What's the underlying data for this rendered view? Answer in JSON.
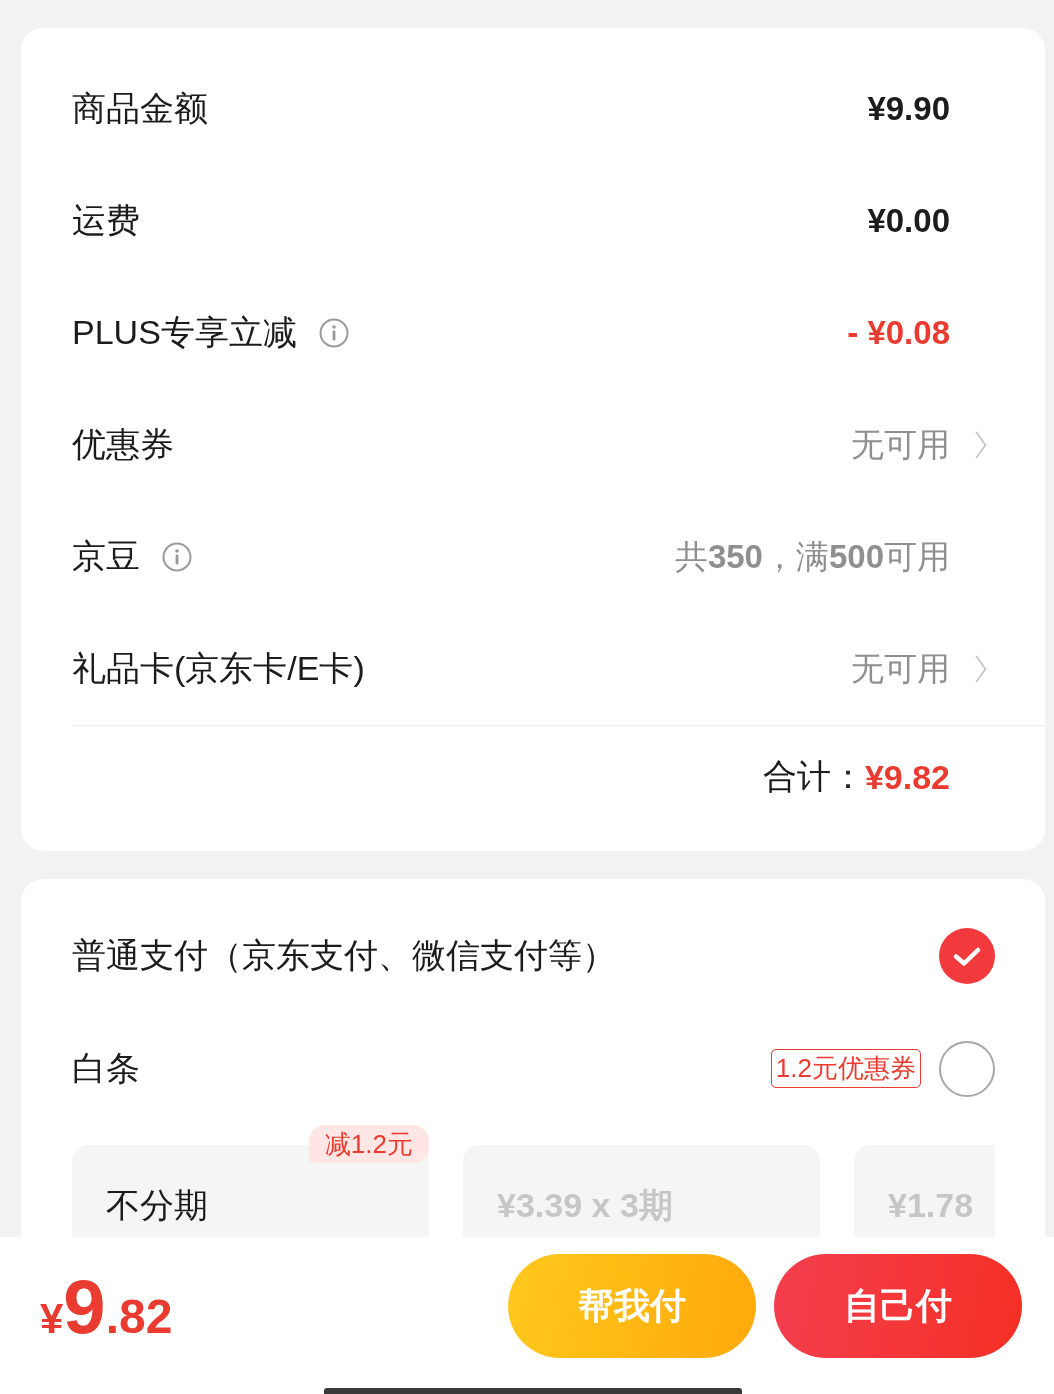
{
  "fee_card": {
    "rows": [
      {
        "label": "商品金额",
        "value": "¥9.90",
        "kind": "amount",
        "info": false,
        "chevron": false
      },
      {
        "label": "运费",
        "value": "¥0.00",
        "kind": "amount",
        "info": false,
        "chevron": false
      },
      {
        "label": "PLUS专享立减",
        "value": "- ¥0.08",
        "kind": "discount",
        "info": true,
        "chevron": false
      },
      {
        "label": "优惠券",
        "value": "无可用",
        "kind": "option",
        "info": false,
        "chevron": true
      },
      {
        "label": "京豆",
        "value": "共**350**，满**500**可用",
        "kind": "option",
        "info": true,
        "chevron": false
      },
      {
        "label": "礼品卡(京东卡/E卡)",
        "value": "无可用",
        "kind": "option",
        "info": false,
        "chevron": true
      }
    ],
    "total": {
      "label": "合计：",
      "value": "¥9.82"
    }
  },
  "payment_card": {
    "methods": [
      {
        "label": "普通支付（京东支付、微信支付等）",
        "selected": true
      },
      {
        "label": "白条",
        "tag": "1.2元优惠券",
        "selected": false
      }
    ],
    "installments": [
      {
        "label": "不分期",
        "badge": "减1.2元",
        "selected": true
      },
      {
        "label": "¥3.39 x 3期",
        "selected": false
      },
      {
        "label": "¥1.78",
        "selected": false
      }
    ]
  },
  "bottom_bar": {
    "price": {
      "currency": "¥",
      "integer": "9",
      "decimal": ".82"
    },
    "buttons": [
      {
        "label": "帮我付",
        "kind": "secondary"
      },
      {
        "label": "自己付",
        "kind": "primary"
      }
    ]
  }
}
